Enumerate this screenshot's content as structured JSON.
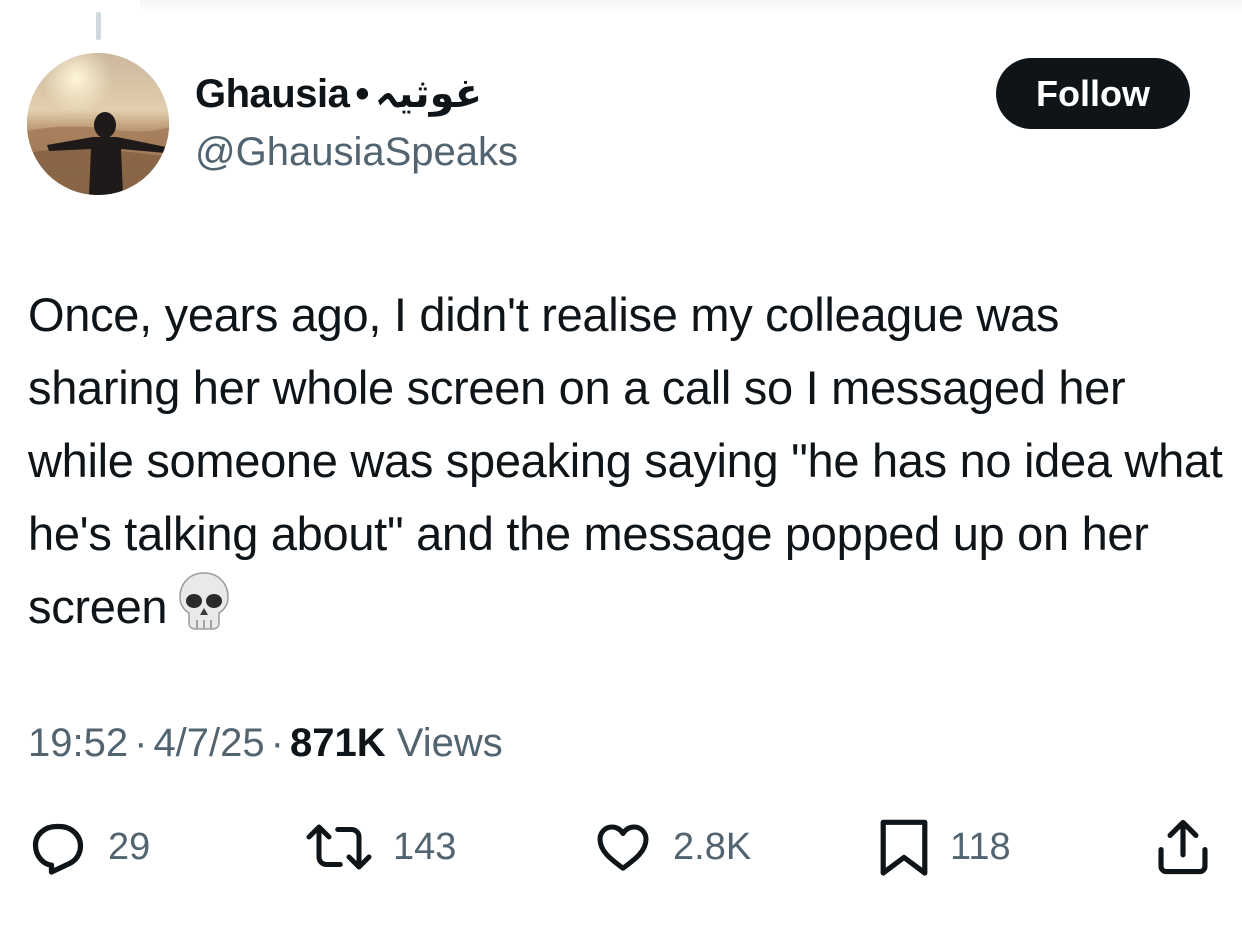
{
  "author": {
    "display_name": "Ghausia",
    "separator": "•",
    "display_name_arabic": "غوثیہ",
    "handle": "@GhausiaSpeaks",
    "avatar_icon": "profile-photo-person-in-desert"
  },
  "follow_button": {
    "label": "Follow"
  },
  "tweet": {
    "text": "Once, years ago, I didn't realise my colleague was sharing her whole screen on a call so I messaged her while someone was speaking saying \"he has no idea what he's talking about\" and the message popped up on her screen",
    "emoji": "skull-emoji"
  },
  "meta": {
    "time": "19:52",
    "date": "4/7/25",
    "views_count": "871K",
    "views_label": "Views",
    "separator": "·"
  },
  "actions": {
    "reply": {
      "icon": "reply-icon",
      "count": "29"
    },
    "retweet": {
      "icon": "retweet-icon",
      "count": "143"
    },
    "like": {
      "icon": "heart-icon",
      "count": "2.8K"
    },
    "bookmark": {
      "icon": "bookmark-icon",
      "count": "118"
    },
    "share": {
      "icon": "share-icon"
    }
  },
  "colors": {
    "text_primary": "#0f1419",
    "text_secondary": "#536471",
    "button_bg": "#0f1419",
    "button_text": "#ffffff"
  }
}
